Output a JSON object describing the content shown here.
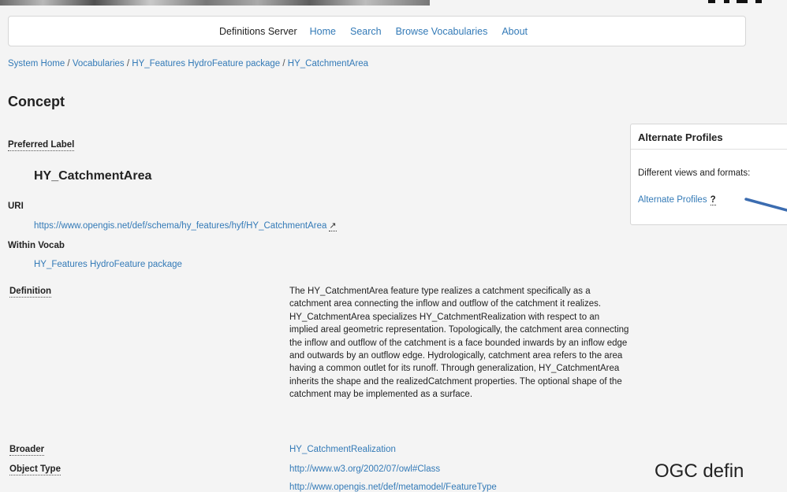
{
  "navbar": {
    "brand": "Definitions Server",
    "links": [
      "Home",
      "Search",
      "Browse Vocabularies",
      "About"
    ]
  },
  "breadcrumb": {
    "items": [
      "System Home",
      "Vocabularies",
      "HY_Features HydroFeature package",
      "HY_CatchmentArea"
    ],
    "separator": " / "
  },
  "page_title": "Concept",
  "preferred_label": {
    "label": "Preferred Label",
    "value": "HY_CatchmentArea"
  },
  "uri": {
    "label": "URI",
    "value": "https://www.opengis.net/def/schema/hy_features/hyf/HY_CatchmentArea",
    "external_icon": "↗"
  },
  "within_vocab": {
    "label": "Within Vocab",
    "value": "HY_Features HydroFeature package"
  },
  "definition": {
    "label": "Definition",
    "text": "The HY_CatchmentArea feature type realizes a catchment specifically as a catchment area connecting the inflow and outflow of the catchment it realizes. HY_CatchmentArea specializes HY_CatchmentRealization with respect to an implied areal geometric representation. Topologically, the catchment area connecting the inflow and outflow of the catchment is a face bounded inwards by an inflow edge and outwards by an outflow edge. Hydrologically, catchment area refers to the area having a common outlet for its runoff. Through generalization, HY_CatchmentArea inherits the shape and the realizedCatchment properties. The optional shape of the catchment may be implemented as a surface."
  },
  "broader": {
    "label": "Broader",
    "value": "HY_CatchmentRealization"
  },
  "object_type": {
    "label": "Object Type",
    "values": [
      "http://www.w3.org/2002/07/owl#Class",
      "http://www.opengis.net/def/metamodel/FeatureType"
    ]
  },
  "alternate_profiles": {
    "heading": "Alternate Profiles",
    "subtext": "Different views and formats:",
    "link": "Alternate Profiles",
    "help": "?"
  },
  "overlay_text": "OGC defin",
  "colors": {
    "link": "#337ab7",
    "arrow": "#3b6cb0",
    "background": "#f4f4f4"
  }
}
